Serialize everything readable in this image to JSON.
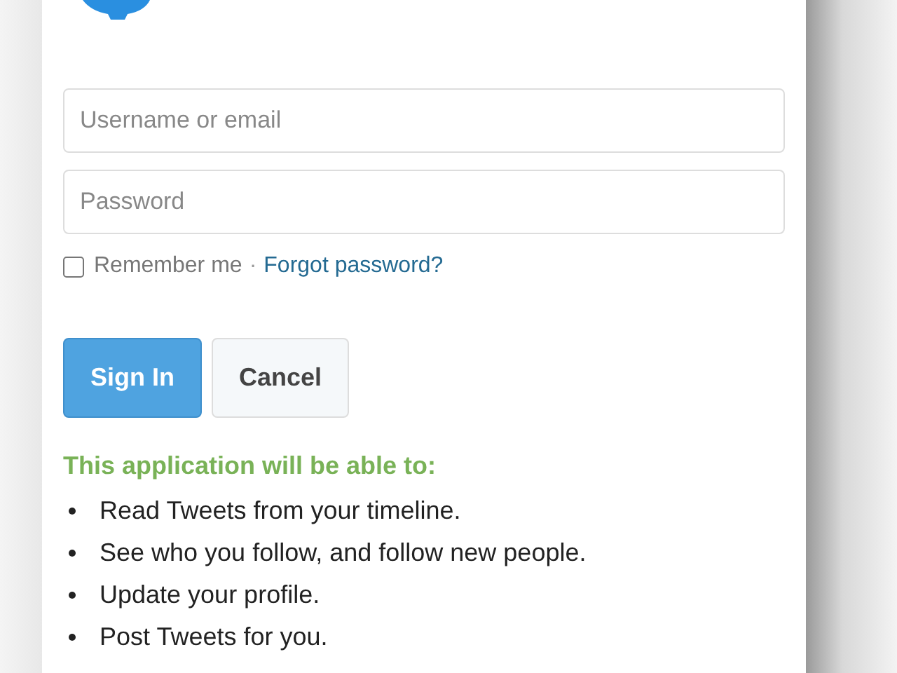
{
  "login_form": {
    "username": {
      "placeholder": "Username or email"
    },
    "password": {
      "placeholder": "Password"
    },
    "remember_me": {
      "label": "Remember me",
      "checked": false
    },
    "separator": "·",
    "forgot_link": "Forgot password?",
    "buttons": [
      {
        "label": "Sign In",
        "kind": "primary"
      },
      {
        "label": "Cancel",
        "kind": "secondary"
      }
    ]
  },
  "permissions": {
    "heading": "This application will be able to:",
    "items": [
      "Read Tweets from your timeline.",
      "See who you follow, and follow new people.",
      "Update your profile.",
      "Post Tweets for you."
    ]
  }
}
